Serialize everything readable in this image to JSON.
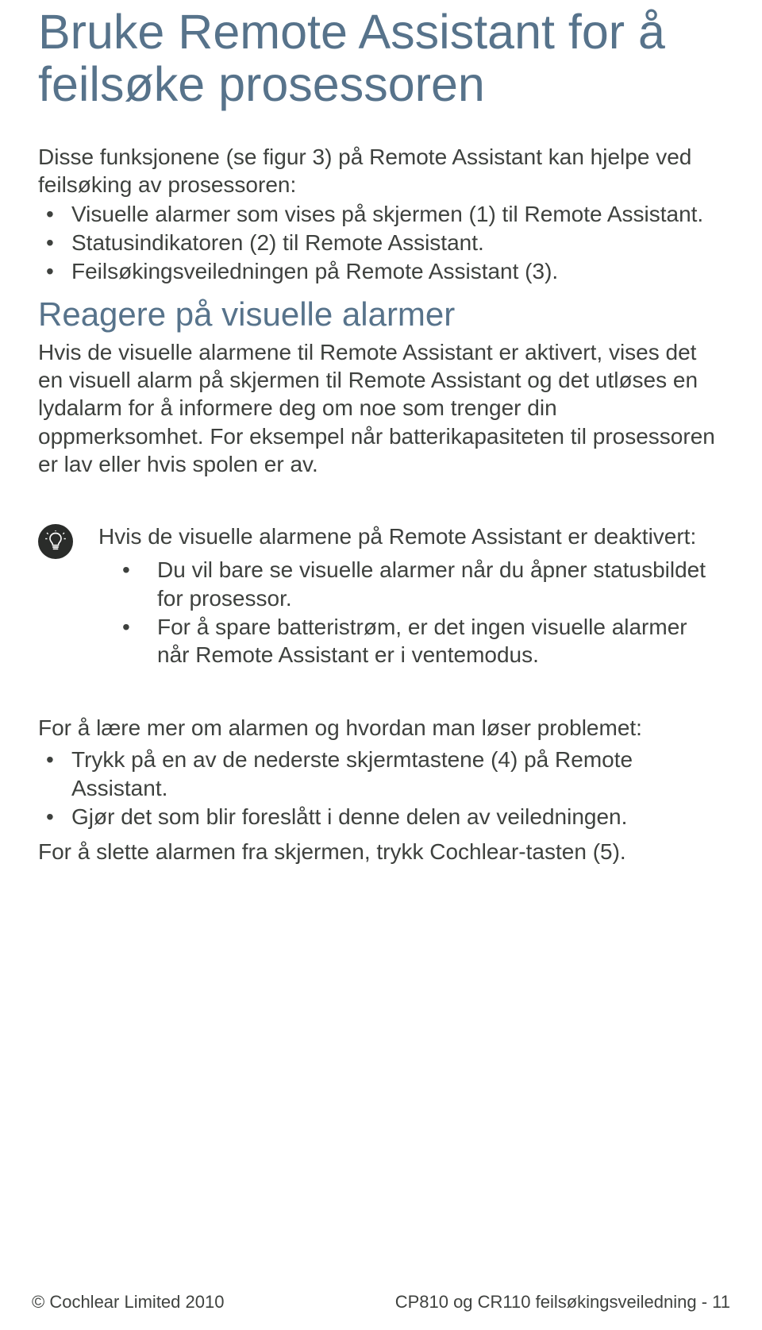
{
  "title_line1": "Bruke Remote Assistant for å",
  "title_line2": "feilsøke prosessoren",
  "intro": "Disse funksjonene (se figur 3) på Remote Assistant kan hjelpe ved feilsøking av prosessoren:",
  "intro_bullets": [
    "Visuelle alarmer som vises på skjermen (1) til Remote Assistant.",
    "Statusindikatoren (2) til Remote Assistant.",
    "Feilsøkingsveiledningen på Remote Assistant (3)."
  ],
  "subheading": "Reagere på visuelle alarmer",
  "body_para": "Hvis de visuelle alarmene til Remote Assistant er aktivert, vises det en visuell alarm på skjermen til Remote Assistant og det utløses en lydalarm for å informere deg om noe som trenger din oppmerksomhet. For eksempel når batterikapasiteten til prosessoren er lav eller hvis spolen er av.",
  "tip_lead": "Hvis de visuelle alarmene på Remote Assistant er deaktivert:",
  "tip_bullets": [
    "Du vil bare se visuelle alarmer når du åpner statusbildet for prosessor.",
    "For å spare batteristrøm, er det ingen visuelle alarmer når Remote Assistant er i ventemodus."
  ],
  "lead2": "For å lære mer om alarmen og hvordan man løser problemet:",
  "lead2_bullets": [
    "Trykk på en av de nederste skjermtastene (4) på Remote Assistant.",
    "Gjør det som blir foreslått i denne delen av veiledningen."
  ],
  "final": "For å slette alarmen fra skjermen, trykk Cochlear-tasten (5).",
  "footer_left": "© Cochlear Limited 2010",
  "footer_right": "CP810 og CR110 feilsøkingsveiledning - 11"
}
